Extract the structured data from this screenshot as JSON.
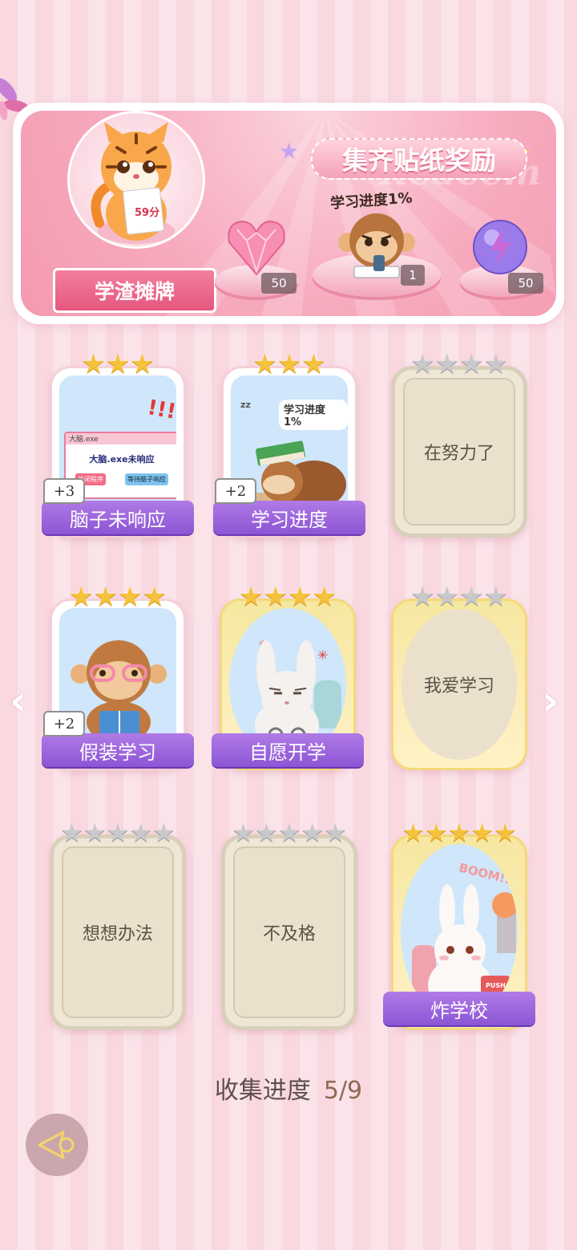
{
  "banner": {
    "title": "集齐贴纸奖励",
    "watermark": "Redeem",
    "character_name": "学渣摊牌",
    "character_score": "59分",
    "progress_caption": "学习进度1%",
    "rewards": [
      {
        "icon": "pink-heart-gem-icon",
        "count": "50"
      },
      {
        "icon": "monkey-sticker-icon",
        "count": "1"
      },
      {
        "icon": "purple-lightning-orb-icon",
        "count": "50"
      }
    ]
  },
  "cards": [
    {
      "label": "脑子未响应",
      "stars": 3,
      "max_stars": 3,
      "plus": "+3",
      "state": "collected",
      "art": {
        "window_title": "大脑.exe",
        "message": "大脑.exe未响应",
        "btn_close": "关闭程序",
        "btn_wait": "等待脑子响应",
        "marks": "!!!"
      }
    },
    {
      "label": "学习进度",
      "stars": 3,
      "max_stars": 3,
      "plus": "+2",
      "state": "collected",
      "art": {
        "bubble": "学习进度1%",
        "zz": "zz"
      }
    },
    {
      "label": "在努力了",
      "stars": 0,
      "max_stars": 4,
      "state": "locked"
    },
    {
      "label": "假装学习",
      "stars": 4,
      "max_stars": 4,
      "plus": "+2",
      "state": "collected"
    },
    {
      "label": "自愿开学",
      "stars": 4,
      "max_stars": 4,
      "state": "collected"
    },
    {
      "label": "我爱学习",
      "stars": 0,
      "max_stars": 4,
      "state": "locked"
    },
    {
      "label": "想想办法",
      "stars": 0,
      "max_stars": 5,
      "state": "locked"
    },
    {
      "label": "不及格",
      "stars": 0,
      "max_stars": 5,
      "state": "locked"
    },
    {
      "label": "炸学校",
      "stars": 5,
      "max_stars": 5,
      "state": "collected",
      "art": {
        "boom": "BOOM!!",
        "button": "PUSH"
      }
    }
  ],
  "collection": {
    "label": "收集进度",
    "value": "5/9"
  },
  "colors": {
    "accent_pink": "#f47f9d",
    "label_purple": "#9b65dd",
    "star_gold": "#f5c23b"
  }
}
